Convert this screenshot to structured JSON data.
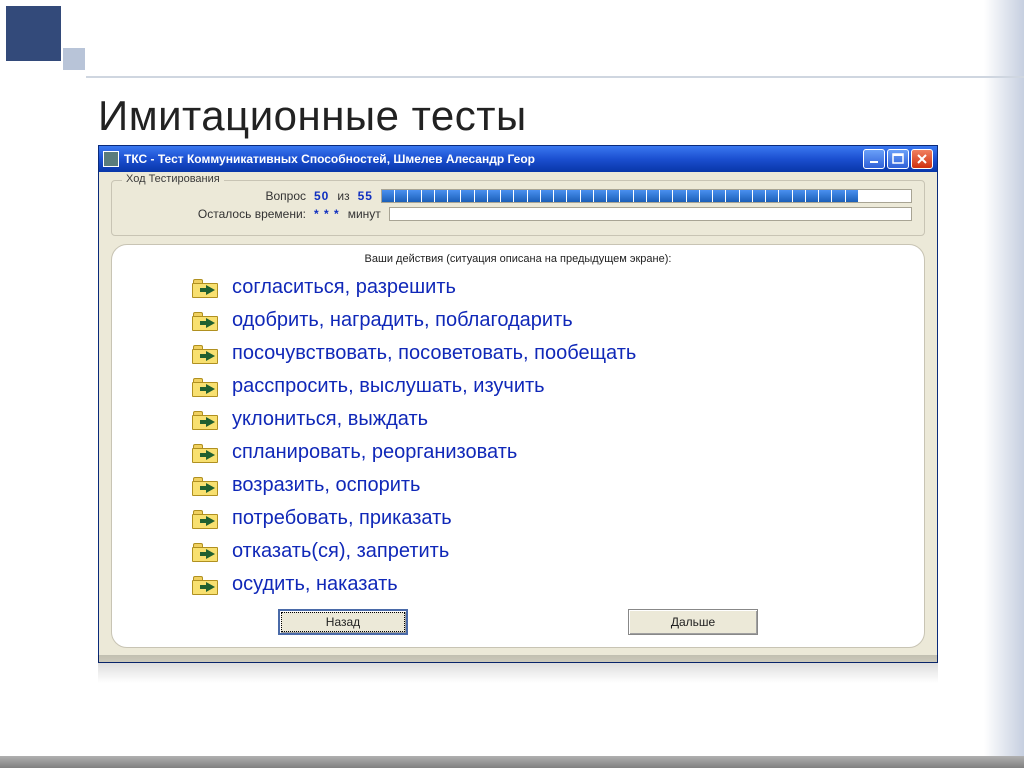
{
  "slide": {
    "title": "Имитационные тесты"
  },
  "window": {
    "title": "ТКС - Тест Коммуникативных Способностей, Шмелев Алесандр Геор",
    "controls": {
      "min": "minimize",
      "max": "maximize",
      "close": "close"
    }
  },
  "status": {
    "group_label": "Ход Тестирования",
    "question_label": "Вопрос",
    "current": "50",
    "sep": "из",
    "total": "55",
    "time_label": "Осталось времени:",
    "time_value": "* * *",
    "time_unit": "минут",
    "progress_pct": 90
  },
  "prompt": "Ваши действия (ситуация описана на предыдущем экране):",
  "options": [
    "согласиться, разрешить",
    "одобрить, наградить, поблагодарить",
    "посочувствовать, посоветовать, пообещать",
    "расспросить, выслушать, изучить",
    "уклониться, выждать",
    "спланировать, реорганизовать",
    "возразить, оспорить",
    "потребовать, приказать",
    "отказать(ся), запретить",
    "осудить, наказать"
  ],
  "buttons": {
    "back": "Назад",
    "next": "Дальше"
  }
}
